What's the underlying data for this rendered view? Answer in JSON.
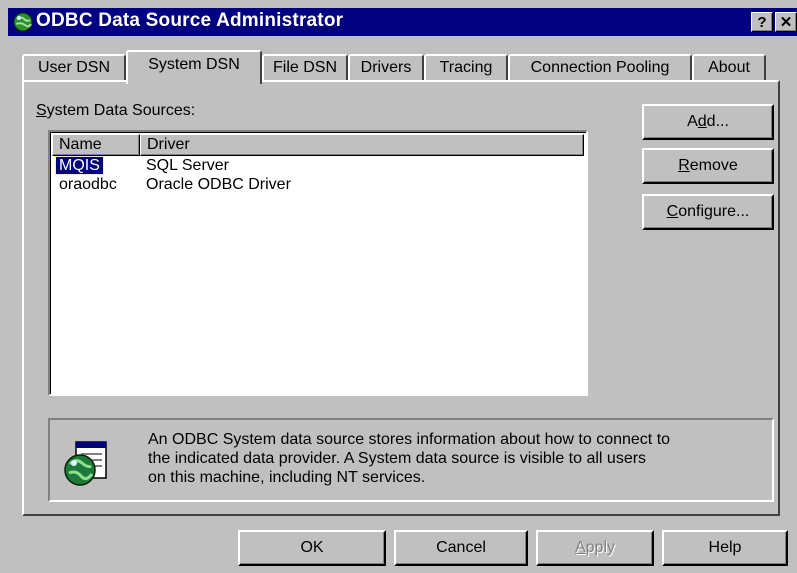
{
  "window": {
    "title": "ODBC Data Source Administrator",
    "help_glyph": "?",
    "close_glyph": "✕",
    "icon": "globe-icon"
  },
  "tabs": [
    {
      "label": "User DSN",
      "active": false
    },
    {
      "label": "System DSN",
      "active": true
    },
    {
      "label": "File DSN",
      "active": false
    },
    {
      "label": "Drivers",
      "active": false
    },
    {
      "label": "Tracing",
      "active": false
    },
    {
      "label": "Connection Pooling",
      "active": false
    },
    {
      "label": "About",
      "active": false
    }
  ],
  "system_dsn": {
    "list_label_prefix": "S",
    "list_label_rest": "ystem Data Sources:",
    "columns": [
      "Name",
      "Driver"
    ],
    "rows": [
      {
        "name": "MQIS",
        "driver": "SQL Server",
        "selected": true
      },
      {
        "name": "oraodbc",
        "driver": "Oracle ODBC Driver",
        "selected": false
      }
    ],
    "buttons": {
      "add": {
        "pre": "A",
        "ul": "d",
        "post": "d..."
      },
      "remove": {
        "pre": "",
        "ul": "R",
        "post": "emove"
      },
      "configure": {
        "pre": "",
        "ul": "C",
        "post": "onfigure..."
      }
    },
    "info_lines": [
      "An ODBC System data source stores information about how to connect to",
      "the indicated data provider.   A System data source is visible to all users",
      "on this machine, including NT services."
    ],
    "info_icon": "odbc-globe-document-icon"
  },
  "footer": {
    "ok": "OK",
    "cancel": "Cancel",
    "apply": {
      "pre": "",
      "ul": "A",
      "post": "pply"
    },
    "help": "Help"
  },
  "colors": {
    "titlebar": "#000080",
    "face": "#c0c0c0",
    "selection": "#000080"
  }
}
